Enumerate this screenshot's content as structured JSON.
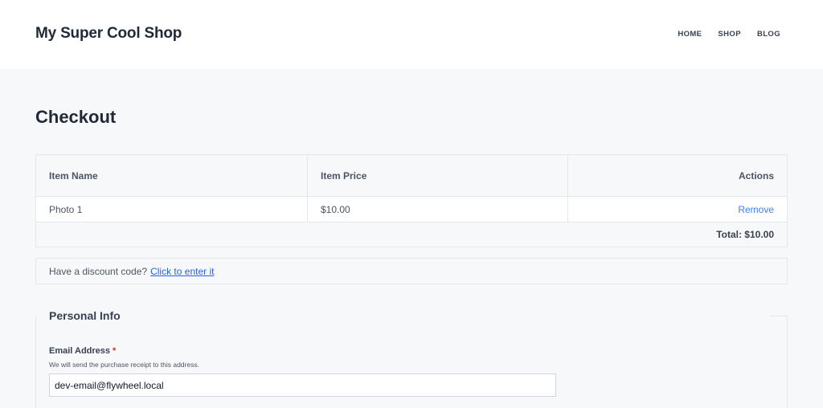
{
  "header": {
    "site_title": "My Super Cool Shop",
    "nav": [
      "HOME",
      "SHOP",
      "BLOG"
    ]
  },
  "page_title": "Checkout",
  "cart": {
    "columns": [
      "Item Name",
      "Item Price",
      "Actions"
    ],
    "items": [
      {
        "name": "Photo 1",
        "price": "$10.00",
        "action": "Remove"
      }
    ],
    "total": "Total: $10.00"
  },
  "discount": {
    "prompt": "Have a discount code?",
    "link": "Click to enter it"
  },
  "personal_info": {
    "legend": "Personal Info",
    "email_label": "Email Address",
    "required_mark": "*",
    "email_help": "We will send the purchase receipt to this address.",
    "email_value": "dev-email@flywheel.local"
  },
  "colors": {
    "accent": "#3b82f6",
    "link": "#2563eb",
    "required": "#dc2626",
    "background": "#f7f8fa"
  }
}
